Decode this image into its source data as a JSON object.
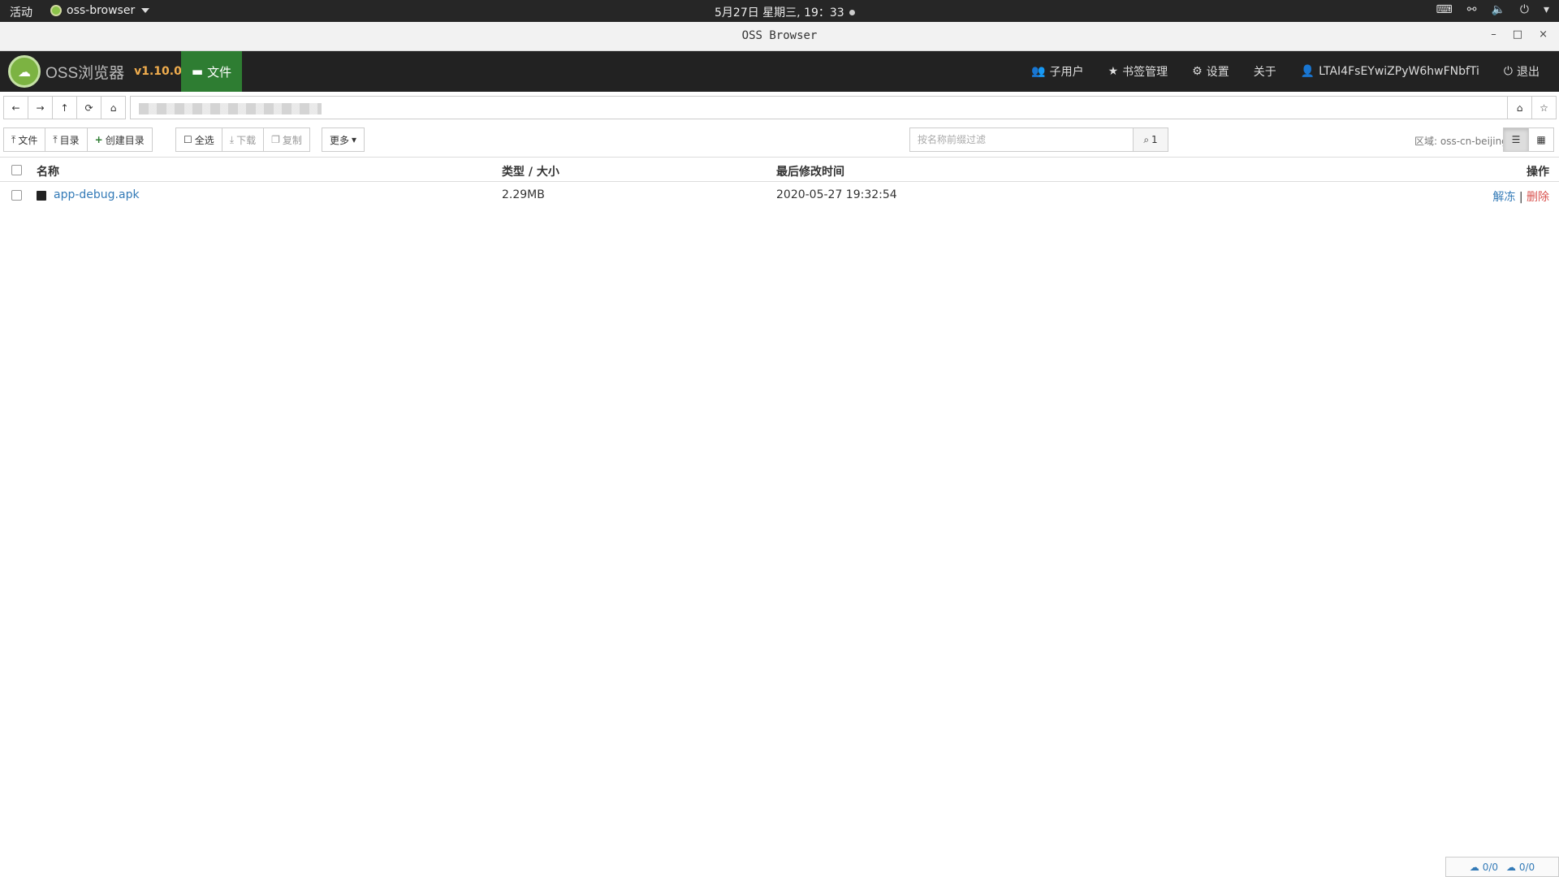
{
  "system_bar": {
    "activities": "活动",
    "app_name": "oss-browser",
    "clock": "5月27日 星期三, 19：33"
  },
  "window": {
    "title": "OSS Browser",
    "minimize": "–",
    "maximize": "□",
    "close": "×"
  },
  "navbar": {
    "brand": "OSS浏览器",
    "version": "v1.10.0",
    "files_tab": "文件",
    "subusers": "子用户",
    "bookmarks": "书签管理",
    "settings": "设置",
    "about": "关于",
    "account": "LTAI4FsEYwiZPyW6hwFNbfTi",
    "logout": "退出"
  },
  "toolbar": {
    "upload_file": "文件",
    "upload_dir": "目录",
    "create_dir": "创建目录",
    "select_all": "全选",
    "download": "下载",
    "copy": "复制",
    "more": "更多",
    "filter_placeholder": "按名称前缀过滤",
    "search_count": "1",
    "region": "区域: oss-cn-beijing"
  },
  "table": {
    "headers": {
      "name": "名称",
      "type_size": "类型 / 大小",
      "modified": "最后修改时间",
      "actions": "操作"
    },
    "rows": [
      {
        "name": "app-debug.apk",
        "size": "2.29MB",
        "modified": "2020-05-27 19:32:54",
        "action_restore": "解冻",
        "separator": "|",
        "action_delete": "删除"
      }
    ]
  },
  "status": {
    "upload": "0/0",
    "download": "0/0"
  },
  "colors": {
    "navbar_bg": "#222222",
    "active_tab": "#2e7d32",
    "version": "#f0ad4e",
    "link": "#337ab7",
    "danger": "#d9534f"
  }
}
